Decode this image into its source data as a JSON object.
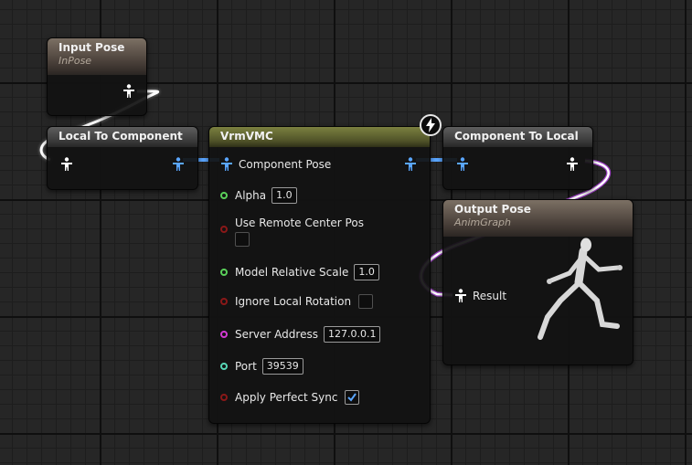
{
  "nodes": {
    "input_pose": {
      "title": "Input Pose",
      "subtitle": "InPose"
    },
    "local_to_component": {
      "title": "Local To Component"
    },
    "vrmvmc": {
      "title": "VrmVMC",
      "component_pose_label": "Component Pose",
      "alpha": {
        "label": "Alpha",
        "value": "1.0"
      },
      "use_remote_center_pos": {
        "label": "Use Remote Center Pos",
        "checked": false
      },
      "model_relative_scale": {
        "label": "Model Relative Scale",
        "value": "1.0"
      },
      "ignore_local_rotation": {
        "label": "Ignore Local Rotation",
        "checked": false
      },
      "server_address": {
        "label": "Server Address",
        "value": "127.0.0.1"
      },
      "port": {
        "label": "Port",
        "value": "39539"
      },
      "apply_perfect_sync": {
        "label": "Apply Perfect Sync",
        "checked": true
      }
    },
    "component_to_local": {
      "title": "Component To Local"
    },
    "output_pose": {
      "title": "Output Pose",
      "subtitle": "AnimGraph",
      "result_label": "Result"
    }
  },
  "icons": {
    "pose_pin": "person-figure-icon",
    "fast_path": "lightning-bolt-icon",
    "preview": "mannequin-running-icon"
  },
  "colors": {
    "pose_pin_blue": "#5aa6ff",
    "pose_pin_white": "#ffffff",
    "bool_pin": "#8a1818",
    "float_pin": "#5ad05a",
    "string_pin": "#d23ad2",
    "int_pin": "#58d6b6",
    "wire_white": "#ffffff",
    "wire_purple": "#9a40c0",
    "header_brown": "#7c7064",
    "header_olive": "#7b8040",
    "header_gray": "#5e5e5e"
  }
}
